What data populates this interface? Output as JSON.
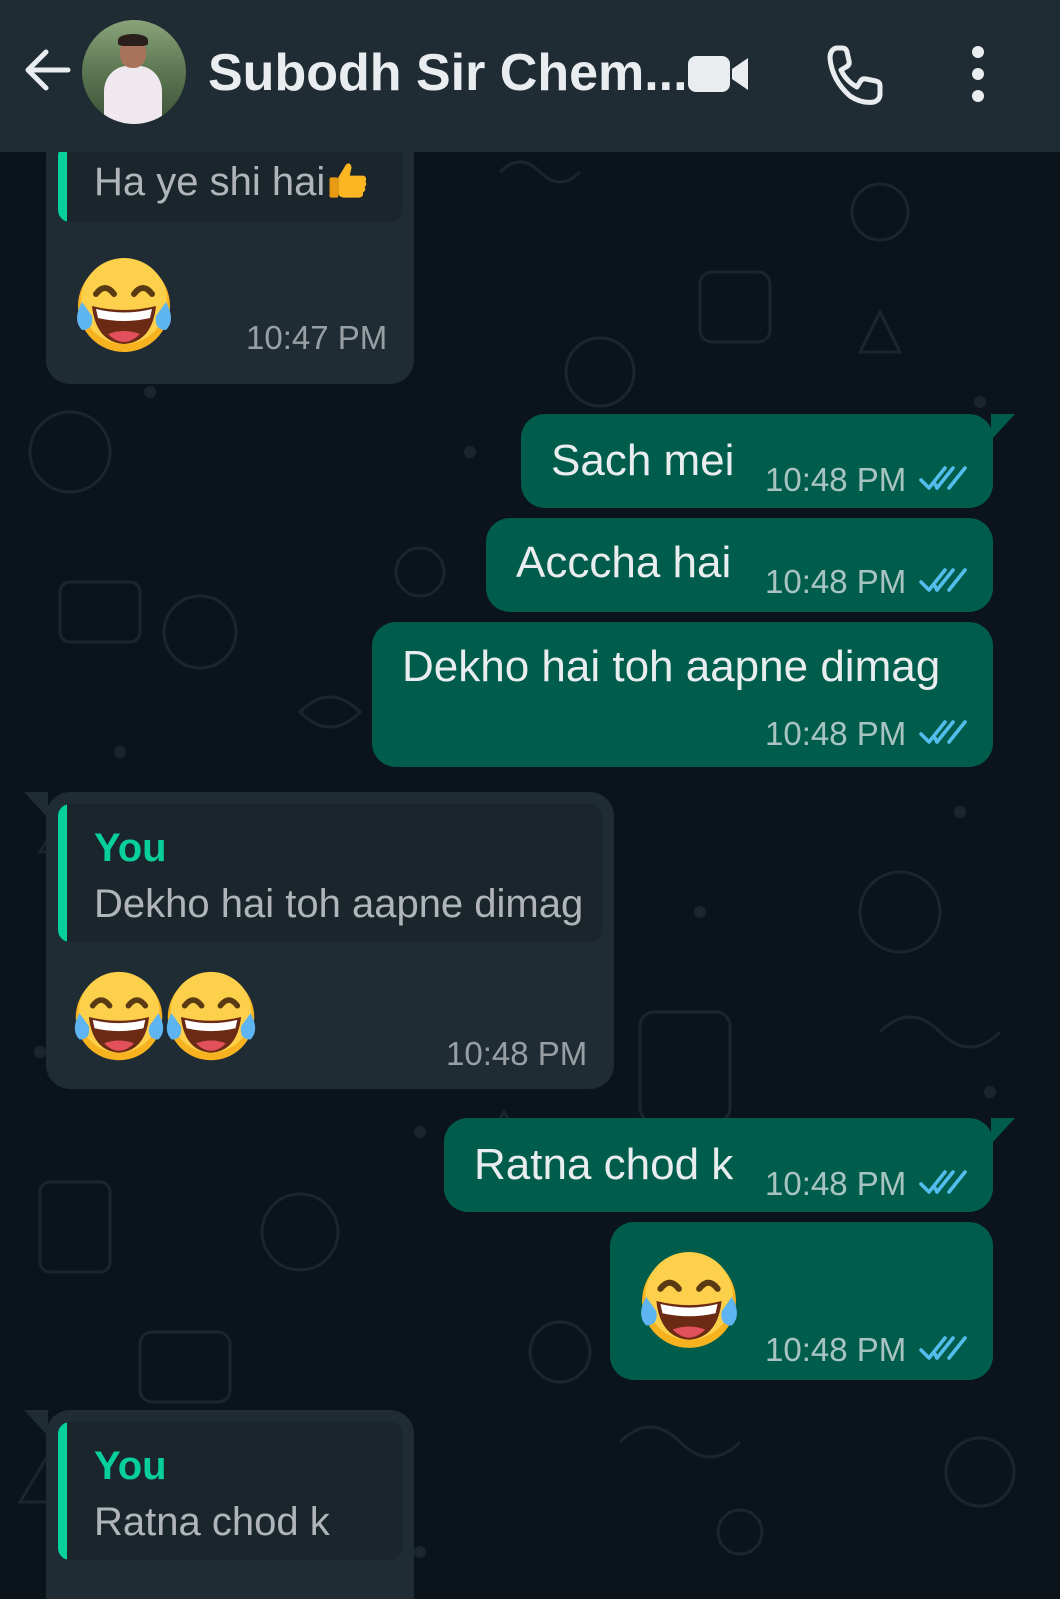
{
  "header": {
    "contact_name": "Subodh Sir Chem...",
    "icons": [
      "back-arrow-icon",
      "video-call-icon",
      "voice-call-icon",
      "more-options-icon"
    ],
    "background_color": "#1f2c34"
  },
  "theme": {
    "chat_background": "#0b141a",
    "incoming_bubble": "#1f2c34",
    "outgoing_bubble": "#005c4b",
    "quote_accent": "#06cf9c",
    "read_tick_color": "#53bdeb"
  },
  "messages": [
    {
      "direction": "in",
      "quote_text": "Ha ye shi hai",
      "quote_emoji": "thumbs-up-emoji",
      "emoji": [
        "face-with-tears-of-joy-emoji"
      ],
      "time": "10:47 PM"
    },
    {
      "direction": "out",
      "text": "Sach mei",
      "time": "10:48 PM",
      "status": "read"
    },
    {
      "direction": "out",
      "text": "Acccha hai",
      "time": "10:48 PM",
      "status": "read"
    },
    {
      "direction": "out",
      "text": "Dekho hai toh aapne dimag",
      "time": "10:48 PM",
      "status": "read"
    },
    {
      "direction": "in",
      "quote_author": "You",
      "quote_text": "Dekho hai toh aapne dimag",
      "emoji": [
        "face-with-tears-of-joy-emoji",
        "face-with-tears-of-joy-emoji"
      ],
      "time": "10:48 PM"
    },
    {
      "direction": "out",
      "text": "Ratna chod k",
      "time": "10:48 PM",
      "status": "read"
    },
    {
      "direction": "out",
      "emoji": [
        "face-with-tears-of-joy-emoji"
      ],
      "time": "10:48 PM",
      "status": "read"
    },
    {
      "direction": "in",
      "quote_author": "You",
      "quote_text": "Ratna chod k"
    }
  ]
}
